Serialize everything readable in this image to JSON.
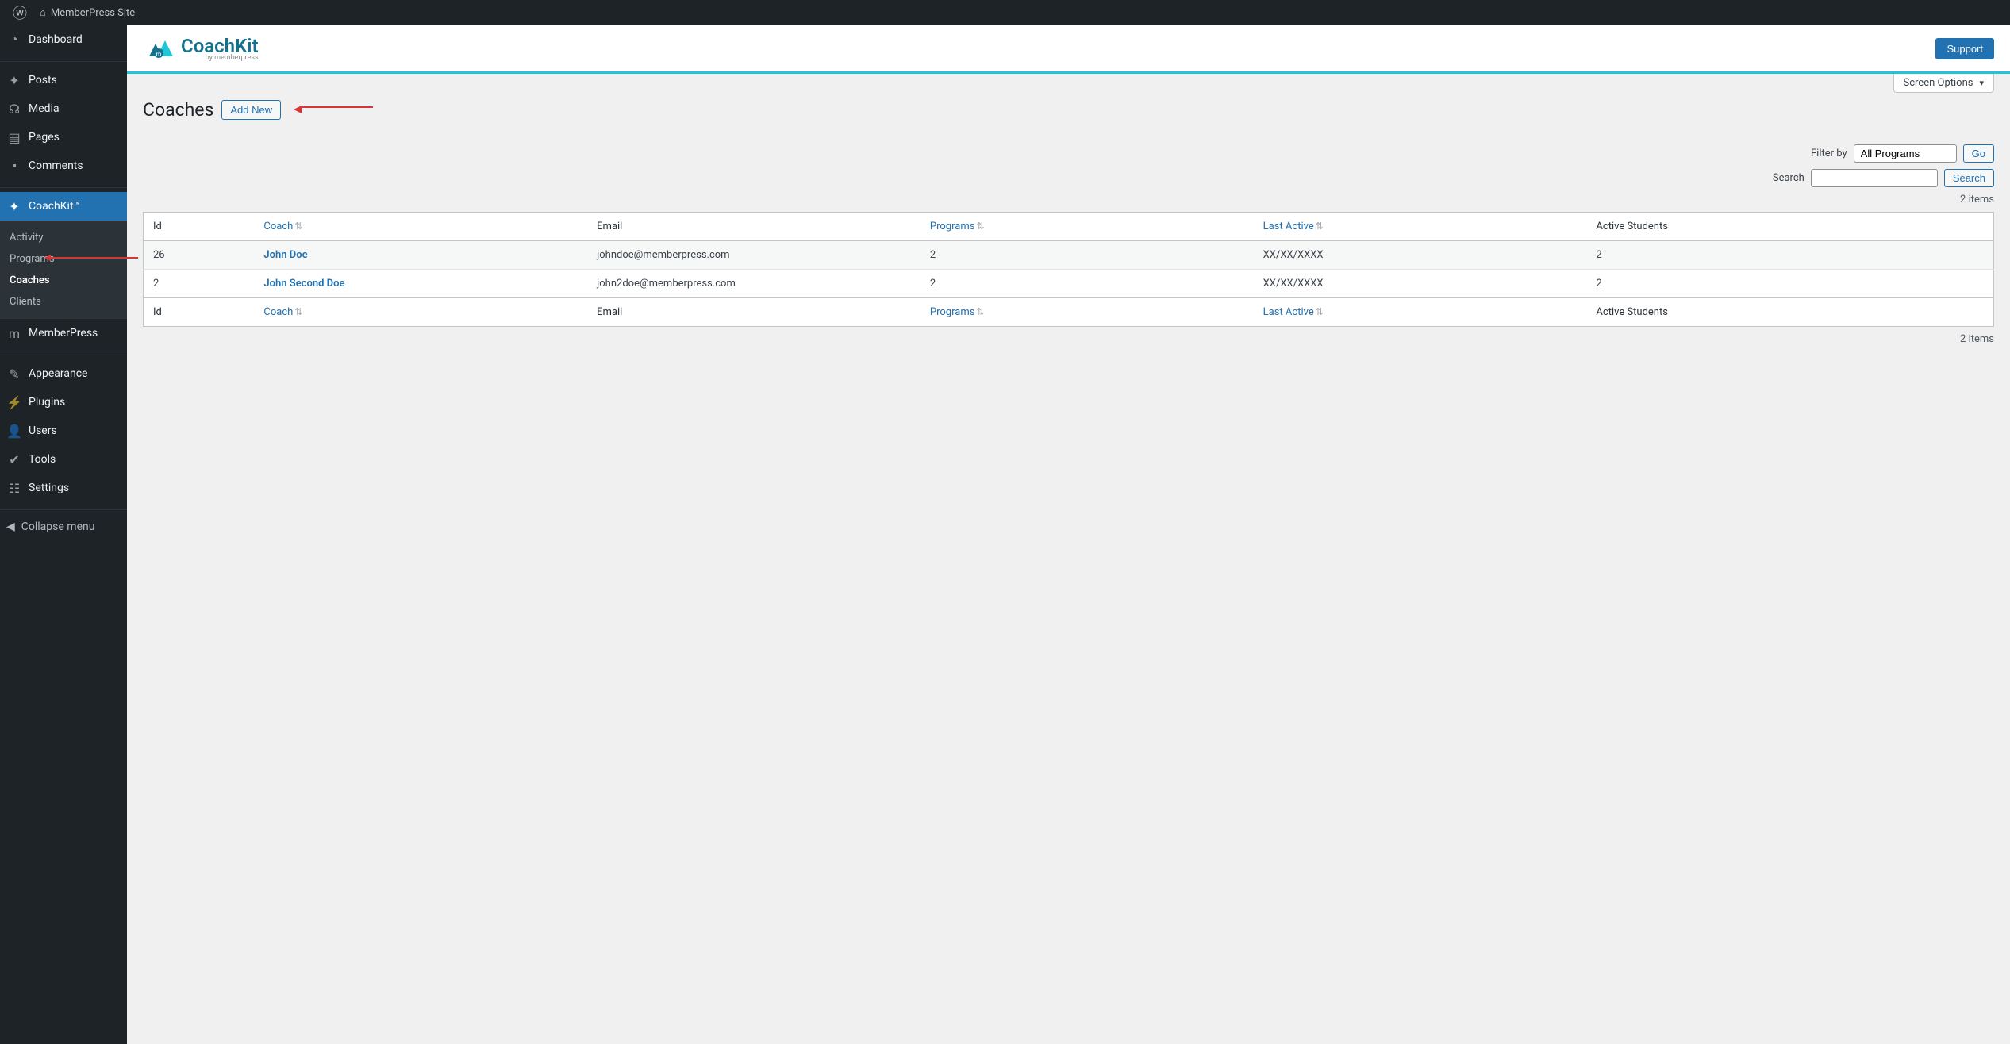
{
  "adminbar": {
    "site_name": "MemberPress Site"
  },
  "sidebar": {
    "items": [
      {
        "label": "Dashboard",
        "icon": "🏠"
      },
      {
        "label": "Posts",
        "icon": "📌"
      },
      {
        "label": "Media",
        "icon": "🖼"
      },
      {
        "label": "Pages",
        "icon": "📄"
      },
      {
        "label": "Comments",
        "icon": "💬"
      },
      {
        "label": "CoachKit™",
        "icon": "⛰"
      },
      {
        "label": "MemberPress",
        "icon": "ⓜ"
      },
      {
        "label": "Appearance",
        "icon": "🖌"
      },
      {
        "label": "Plugins",
        "icon": "🔌"
      },
      {
        "label": "Users",
        "icon": "👤"
      },
      {
        "label": "Tools",
        "icon": "🔧"
      },
      {
        "label": "Settings",
        "icon": "⚙"
      }
    ],
    "submenu": [
      "Activity",
      "Programs",
      "Coaches",
      "Clients"
    ],
    "collapse": "Collapse menu"
  },
  "header": {
    "logo_main": "CoachKit",
    "logo_sub": "by memberpress",
    "support": "Support"
  },
  "page": {
    "screen_options": "Screen Options",
    "title": "Coaches",
    "add_new": "Add New",
    "filter_label": "Filter by",
    "filter_value": "All Programs",
    "go": "Go",
    "search_label": "Search",
    "search_btn": "Search",
    "items_count": "2 items",
    "columns": {
      "id": "Id",
      "coach": "Coach",
      "email": "Email",
      "programs": "Programs",
      "last_active": "Last Active",
      "students": "Active Students"
    },
    "rows": [
      {
        "id": "26",
        "coach": "John Doe",
        "email": "johndoe@memberpress.com",
        "programs": "2",
        "last_active": "XX/XX/XXXX",
        "students": "2"
      },
      {
        "id": "2",
        "coach": "John Second Doe",
        "email": "john2doe@memberpress.com",
        "programs": "2",
        "last_active": "XX/XX/XXXX",
        "students": "2"
      }
    ]
  }
}
